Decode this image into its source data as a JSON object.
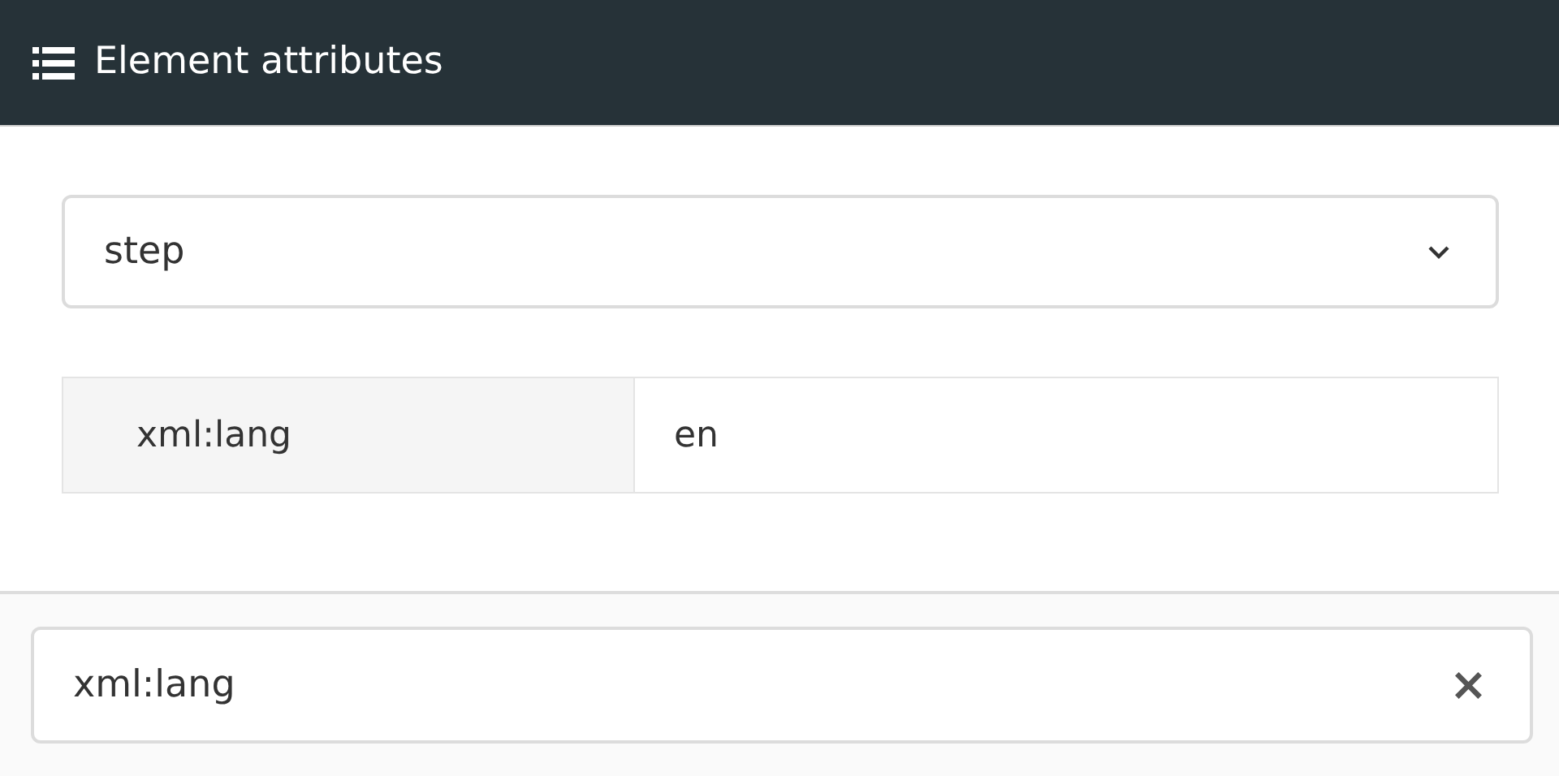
{
  "header": {
    "title": "Element attributes"
  },
  "element_select": {
    "value": "step"
  },
  "attributes": [
    {
      "name": "xml:lang",
      "value": "en"
    }
  ],
  "filter": {
    "value": "xml:lang",
    "clear_icon": "×"
  }
}
